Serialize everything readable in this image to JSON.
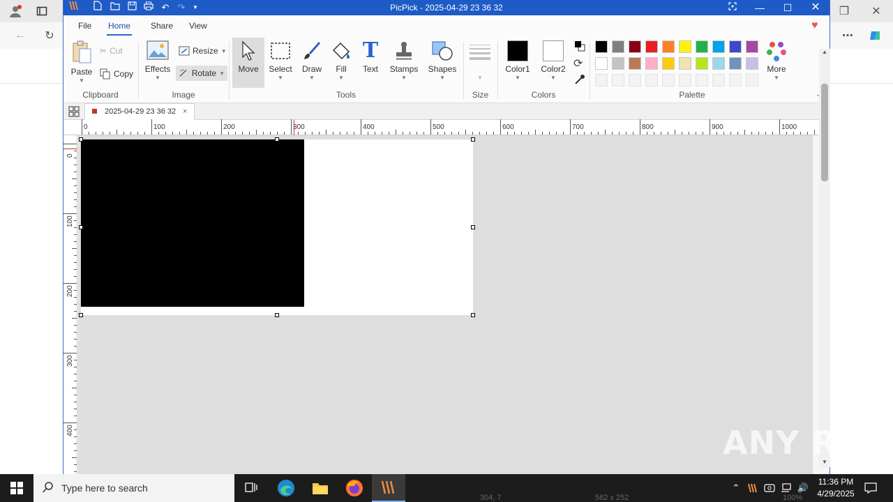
{
  "window": {
    "title": "PicPick - 2025-04-29 23 36 32"
  },
  "menu": [
    "File",
    "Home",
    "Share",
    "View"
  ],
  "ribbon": {
    "clipboard": {
      "paste": "Paste",
      "cut": "Cut",
      "copy": "Copy",
      "group": "Clipboard"
    },
    "image": {
      "effects": "Effects",
      "resize": "Resize",
      "rotate": "Rotate",
      "group": "Image"
    },
    "tools": {
      "move": "Move",
      "select": "Select",
      "draw": "Draw",
      "fill": "Fill",
      "text": "Text",
      "stamps": "Stamps",
      "shapes": "Shapes",
      "group": "Tools"
    },
    "size": {
      "group": "Size"
    },
    "colors": {
      "color1": "Color1",
      "color2": "Color2",
      "group": "Colors",
      "color1_value": "#000000",
      "color2_value": "#ffffff"
    },
    "palette": {
      "group": "Palette",
      "more": "More",
      "row1": [
        "#000000",
        "#7f7f7f",
        "#880015",
        "#ed1c24",
        "#ff7f27",
        "#fff200",
        "#22b14c",
        "#00a2e8",
        "#3f48cc",
        "#a349a4"
      ],
      "row2": [
        "#ffffff",
        "#c3c3c3",
        "#b97a57",
        "#ffaec9",
        "#ffc90e",
        "#efe4b0",
        "#b5e61d",
        "#99d9ea",
        "#7092be",
        "#c8bfe7"
      ],
      "row3": [
        "#f3f3f3",
        "#f3f3f3",
        "#f3f3f3",
        "#f3f3f3",
        "#f3f3f3",
        "#f3f3f3",
        "#f3f3f3",
        "#f3f3f3",
        "#f3f3f3",
        "#f3f3f3"
      ]
    }
  },
  "tab": {
    "label": "2025-04-29 23 36 32"
  },
  "ruler": {
    "h": [
      "0",
      "100",
      "200",
      "300",
      "400",
      "500",
      "600",
      "700",
      "800",
      "900",
      "1000"
    ],
    "v": [
      "0",
      "100",
      "200",
      "300",
      "400"
    ]
  },
  "status": {
    "position": "304, 7",
    "size": "562 x 252",
    "zoom": "100%"
  },
  "taskbar": {
    "search_placeholder": "Type here to search",
    "time": "11:36 PM",
    "date": "4/29/2025"
  },
  "watermark": "ANY RUN"
}
